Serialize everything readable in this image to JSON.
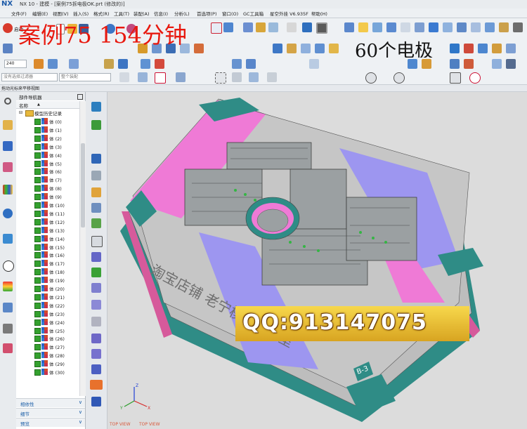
{
  "window": {
    "logo": "NX",
    "title": "NX 10 - 建模 - [案例75拆电极OK.prt (修改的)]"
  },
  "menu": [
    "文件(F)",
    "编辑(E)",
    "视图(V)",
    "插入(S)",
    "格式(R)",
    "工具(T)",
    "装配(A)",
    "信息(I)",
    "分析(L)",
    "首选项(P)",
    "窗口(O)",
    "GC工具箱",
    "星空外挂 V6.935F",
    "帮助(H)"
  ],
  "overlay": {
    "left": "案例75  154分钟",
    "right": "60个电极"
  },
  "toolbar": {
    "start_label": "启动",
    "value_240": "240",
    "filter_placeholder": "没有选择过滤器",
    "assembly_placeholder": "整个装配",
    "status_text": "拖动光标来平移视图"
  },
  "navigator": {
    "title": "部件导航器",
    "column": "名称",
    "root": "模型历史记录",
    "items": [
      "体 (0)",
      "体 (1)",
      "体 (2)",
      "体 (3)",
      "体 (4)",
      "体 (5)",
      "体 (6)",
      "体 (7)",
      "体 (8)",
      "体 (9)",
      "体 (10)",
      "体 (11)",
      "体 (12)",
      "体 (13)",
      "体 (14)",
      "体 (15)",
      "体 (16)",
      "体 (17)",
      "体 (18)",
      "体 (19)",
      "体 (20)",
      "体 (21)",
      "体 (22)",
      "体 (23)",
      "体 (24)",
      "体 (25)",
      "体 (26)",
      "体 (27)",
      "体 (28)",
      "体 (29)",
      "体 (30)"
    ],
    "sections": [
      "相依性",
      "细节",
      "预览"
    ]
  },
  "viewport": {
    "engraving": "淘宝店铺 老宁模具工作室",
    "plate_tag": "B-3",
    "qq_banner": "QQ:913147075",
    "view_label_1": "TOP VIEW",
    "view_label_2": "TOP VIEW",
    "axis_x": "X",
    "axis_y": "Y",
    "axis_z": "Z"
  },
  "colors": {
    "teal": "#2f8c86",
    "pink": "#ef7ad6",
    "violet": "#9d96f0",
    "gray": "#c9c9c9"
  }
}
